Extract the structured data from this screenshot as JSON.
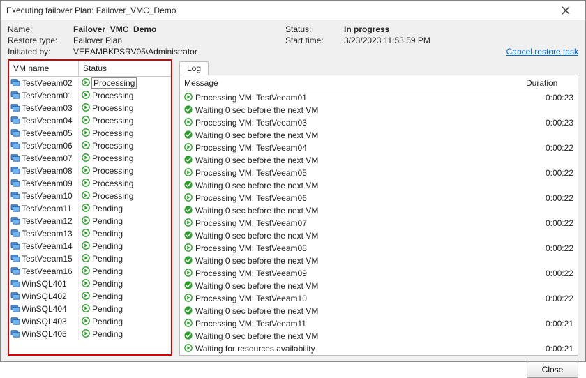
{
  "title": "Executing failover Plan: Failover_VMC_Demo",
  "header": {
    "name_label": "Name:",
    "name_value": "Failover_VMC_Demo",
    "restore_type_label": "Restore type:",
    "restore_type_value": "Failover Plan",
    "initiated_by_label": "Initiated by:",
    "initiated_by_value": "VEEAMBKPSRV05\\Administrator",
    "status_label": "Status:",
    "status_value": "In progress",
    "start_time_label": "Start time:",
    "start_time_value": "3/23/2023 11:53:59 PM",
    "cancel_link": "Cancel restore task"
  },
  "vm_table": {
    "col_name": "VM name",
    "col_status": "Status",
    "rows": [
      {
        "name": "TestVeeam02",
        "status": "Processing",
        "selected": true
      },
      {
        "name": "TestVeeam01",
        "status": "Processing"
      },
      {
        "name": "TestVeeam03",
        "status": "Processing"
      },
      {
        "name": "TestVeeam04",
        "status": "Processing"
      },
      {
        "name": "TestVeeam05",
        "status": "Processing"
      },
      {
        "name": "TestVeeam06",
        "status": "Processing"
      },
      {
        "name": "TestVeeam07",
        "status": "Processing"
      },
      {
        "name": "TestVeeam08",
        "status": "Processing"
      },
      {
        "name": "TestVeeam09",
        "status": "Processing"
      },
      {
        "name": "TestVeeam10",
        "status": "Processing"
      },
      {
        "name": "TestVeeam11",
        "status": "Pending"
      },
      {
        "name": "TestVeeam12",
        "status": "Pending"
      },
      {
        "name": "TestVeeam13",
        "status": "Pending"
      },
      {
        "name": "TestVeeam14",
        "status": "Pending"
      },
      {
        "name": "TestVeeam15",
        "status": "Pending"
      },
      {
        "name": "TestVeeam16",
        "status": "Pending"
      },
      {
        "name": "WinSQL401",
        "status": "Pending"
      },
      {
        "name": "WinSQL402",
        "status": "Pending"
      },
      {
        "name": "WinSQL404",
        "status": "Pending"
      },
      {
        "name": "WinSQL403",
        "status": "Pending"
      },
      {
        "name": "WinSQL405",
        "status": "Pending"
      }
    ]
  },
  "log": {
    "tab_label": "Log",
    "col_message": "Message",
    "col_duration": "Duration",
    "rows": [
      {
        "icon": "play",
        "msg": "Processing VM: TestVeeam01",
        "dur": "0:00:23"
      },
      {
        "icon": "check",
        "msg": "Waiting 0 sec before the next VM",
        "dur": ""
      },
      {
        "icon": "play",
        "msg": "Processing VM: TestVeeam03",
        "dur": "0:00:23"
      },
      {
        "icon": "check",
        "msg": "Waiting 0 sec before the next VM",
        "dur": ""
      },
      {
        "icon": "play",
        "msg": "Processing VM: TestVeeam04",
        "dur": "0:00:22"
      },
      {
        "icon": "check",
        "msg": "Waiting 0 sec before the next VM",
        "dur": ""
      },
      {
        "icon": "play",
        "msg": "Processing VM: TestVeeam05",
        "dur": "0:00:22"
      },
      {
        "icon": "check",
        "msg": "Waiting 0 sec before the next VM",
        "dur": ""
      },
      {
        "icon": "play",
        "msg": "Processing VM: TestVeeam06",
        "dur": "0:00:22"
      },
      {
        "icon": "check",
        "msg": "Waiting 0 sec before the next VM",
        "dur": ""
      },
      {
        "icon": "play",
        "msg": "Processing VM: TestVeeam07",
        "dur": "0:00:22"
      },
      {
        "icon": "check",
        "msg": "Waiting 0 sec before the next VM",
        "dur": ""
      },
      {
        "icon": "play",
        "msg": "Processing VM: TestVeeam08",
        "dur": "0:00:22"
      },
      {
        "icon": "check",
        "msg": "Waiting 0 sec before the next VM",
        "dur": ""
      },
      {
        "icon": "play",
        "msg": "Processing VM: TestVeeam09",
        "dur": "0:00:22"
      },
      {
        "icon": "check",
        "msg": "Waiting 0 sec before the next VM",
        "dur": ""
      },
      {
        "icon": "play",
        "msg": "Processing VM: TestVeeam10",
        "dur": "0:00:22"
      },
      {
        "icon": "check",
        "msg": "Waiting 0 sec before the next VM",
        "dur": ""
      },
      {
        "icon": "play",
        "msg": "Processing VM: TestVeeam11",
        "dur": "0:00:21"
      },
      {
        "icon": "check",
        "msg": "Waiting 0 sec before the next VM",
        "dur": ""
      },
      {
        "icon": "play",
        "msg": "Waiting for resources availability",
        "dur": "0:00:21"
      }
    ]
  },
  "footer": {
    "close_label": "Close"
  }
}
